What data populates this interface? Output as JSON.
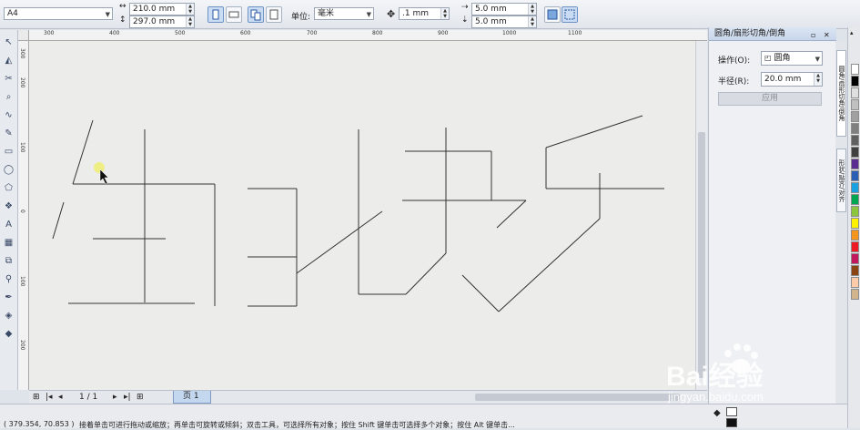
{
  "property_bar": {
    "paper_size": "A4",
    "page_width": "210.0 mm",
    "page_height": "297.0 mm",
    "units_label": "单位:",
    "units_value": "毫米",
    "nudge_value": ".1 mm",
    "dup_x": "5.0 mm",
    "dup_y": "5.0 mm"
  },
  "rulers": {
    "h_ticks": [
      "300",
      "400",
      "500",
      "600",
      "700",
      "800",
      "900",
      "1000",
      "1100"
    ],
    "v_ticks": [
      "300",
      "200",
      "100",
      "0",
      "100",
      "200"
    ]
  },
  "pager": {
    "page_count": "1 / 1",
    "page_tab": "页 1"
  },
  "docker": {
    "title": "圆角/扇形切角/倒角",
    "operation_label": "操作(O):",
    "operation_value": "圆角",
    "radius_label": "半径(R):",
    "radius_value": "20.0 mm",
    "apply_label": "应用"
  },
  "side_tabs": [
    "圆角/扇形切角/倒角",
    "形状/贴齐/对齐"
  ],
  "status": {
    "coordinates": "( 379.354, 70.853 )",
    "hint": "接着单击可进行拖动或缩放；再单击可旋转或倾斜；双击工具，可选择所有对象；按住 Shift 键单击可选择多个对象；按住 Alt 键单击..."
  },
  "watermark": {
    "brand": "Bai经验",
    "url": "jingyan.baidu.com"
  },
  "colors": {
    "accent": "#c9dcf3",
    "canvas": "#ececeb",
    "stroke": "#333333",
    "cursor_highlight": "#f0ef6a"
  },
  "palette": [
    "#ffffff",
    "#000000",
    "#e0e0e0",
    "#c0c0c0",
    "#a0a0a0",
    "#808080",
    "#606060",
    "#404040",
    "#5c2d91",
    "#2b5fb6",
    "#1ba1e2",
    "#00a650",
    "#8cc63f",
    "#fff200",
    "#f7941d",
    "#ed1c24",
    "#c2185b",
    "#8b4513",
    "#ffccaa",
    "#d2b48c"
  ]
}
